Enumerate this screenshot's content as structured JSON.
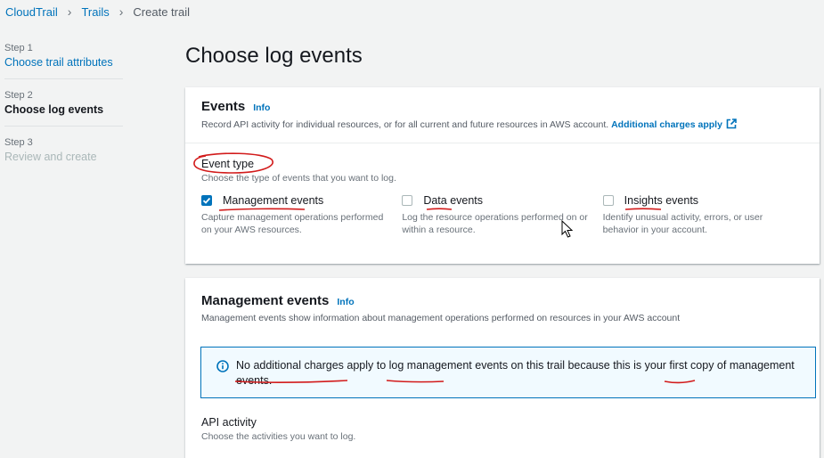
{
  "breadcrumb": {
    "items": [
      "CloudTrail",
      "Trails"
    ],
    "current": "Create trail"
  },
  "steps": [
    {
      "num": "Step 1",
      "label": "Choose trail attributes"
    },
    {
      "num": "Step 2",
      "label": "Choose log events"
    },
    {
      "num": "Step 3",
      "label": "Review and create"
    }
  ],
  "page_title": "Choose log events",
  "events_card": {
    "title": "Events",
    "info": "Info",
    "description": "Record API activity for individual resources, or for all current and future resources in AWS account.",
    "charges_link": "Additional charges apply",
    "event_type": {
      "label": "Event type",
      "description": "Choose the type of events that you want to log.",
      "options": [
        {
          "label": "Management events",
          "checked": true,
          "description": "Capture management operations performed on your AWS resources."
        },
        {
          "label": "Data events",
          "checked": false,
          "description": "Log the resource operations performed on or within a resource."
        },
        {
          "label": "Insights events",
          "checked": false,
          "description": "Identify unusual activity, errors, or user behavior in your account."
        }
      ]
    }
  },
  "management_card": {
    "title": "Management events",
    "info": "Info",
    "description": "Management events show information about management operations performed on resources in your AWS account",
    "alert": {
      "parts": [
        "No additional charges",
        " apply to ",
        "log management",
        " events on this trail because this is your ",
        "first",
        " ",
        "copy",
        " of management events."
      ]
    },
    "api_activity": {
      "label": "API activity",
      "description": "Choose the activities you want to log."
    }
  },
  "colors": {
    "link": "#0073bb",
    "annotation": "#d21b1b",
    "background": "#f2f3f3",
    "alert_bg": "#f1faff"
  }
}
